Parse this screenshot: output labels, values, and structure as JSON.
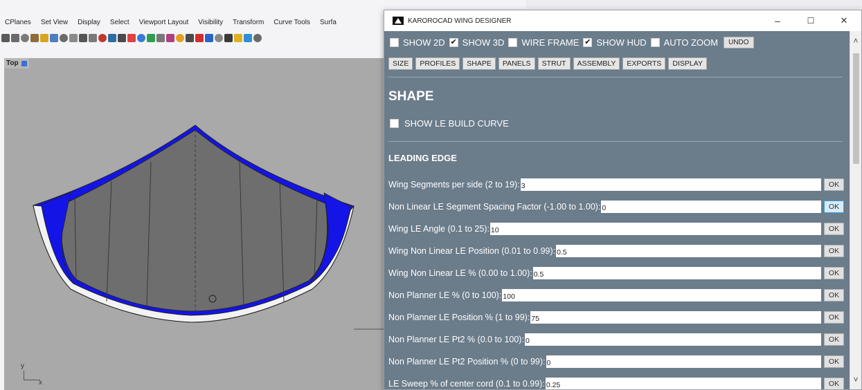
{
  "rhino": {
    "menu": [
      "CPlanes",
      "Set View",
      "Display",
      "Select",
      "Viewport Layout",
      "Visibility",
      "Transform",
      "Curve Tools",
      "Surfa"
    ],
    "viewport_label": "Top",
    "axis_y": "y",
    "axis_x": "x",
    "toolbar_colors": [
      "#5a5a5a",
      "#6b6b6b",
      "#7a7a7a",
      "#8c6d3b",
      "#d9a520",
      "#4a7fc1",
      "#6a6a6a",
      "#8a8a8a",
      "#555555",
      "#7a7a7a",
      "#c0392b",
      "#2e6da4",
      "#4a4a4a",
      "#e04040",
      "#3a7ad8",
      "#2e9e4f",
      "#777777",
      "#b04080",
      "#e6a020",
      "#4a4a4a",
      "#d03030",
      "#2a64c8",
      "#888888",
      "#3a3a3a",
      "#e0b020",
      "#2e8fd6",
      "#6a6a6a"
    ]
  },
  "kwin": {
    "title": "KAROROCAD WING DESIGNER",
    "min_glyph": "–",
    "max_glyph": "☐",
    "close_glyph": "✕",
    "checks": [
      {
        "label": "SHOW 2D",
        "checked": false
      },
      {
        "label": "SHOW 3D",
        "checked": true
      },
      {
        "label": "WIRE FRAME",
        "checked": false
      },
      {
        "label": "SHOW HUD",
        "checked": true
      },
      {
        "label": "AUTO ZOOM",
        "checked": false
      }
    ],
    "undo_label": "UNDO",
    "tabs": [
      "SIZE",
      "PROFILES",
      "SHAPE",
      "PANELS",
      "STRUT",
      "ASSEMBLY",
      "EXPORTS",
      "DISPLAY"
    ],
    "section_title": "SHAPE",
    "le_build_curve_label": "SHOW LE BUILD CURVE",
    "subsection_title": "LEADING EDGE",
    "ok_label": "OK",
    "params": [
      {
        "label": "Wing Segments per side (2 to 19):",
        "value": "3"
      },
      {
        "label": "Non Linear LE Segment Spacing Factor (-1.00 to 1.00):",
        "value": "0"
      },
      {
        "label": "Wing LE Angle (0.1 to 25):",
        "value": "10"
      },
      {
        "label": "Wing Non Linear LE Position (0.01 to 0.99):",
        "value": "0.5"
      },
      {
        "label": "Wing Non Linear LE % (0.00 to 1.00):",
        "value": "0.5"
      },
      {
        "label": "Non Planner LE % (0 to 100):",
        "value": "100"
      },
      {
        "label": "Non Planner LE Position % (1 to 99):",
        "value": "75"
      },
      {
        "label": "Non Planner LE Pt2 % (0.0 to 100):",
        "value": "0"
      },
      {
        "label": "Non Planner LE Pt2 Position % (0 to 99):",
        "value": "0"
      },
      {
        "label": "LE Sweep % of center cord (0.1 to 0.99):",
        "value": "0.25"
      }
    ],
    "scroll_up_glyph": "˄",
    "scroll_down_glyph": "˅",
    "colors": {
      "panel_bg": "#6b7c8b",
      "wing_fill": "#6e6e6e",
      "wing_le": "#1414e6",
      "ok_active": "#d7ecfa"
    }
  }
}
